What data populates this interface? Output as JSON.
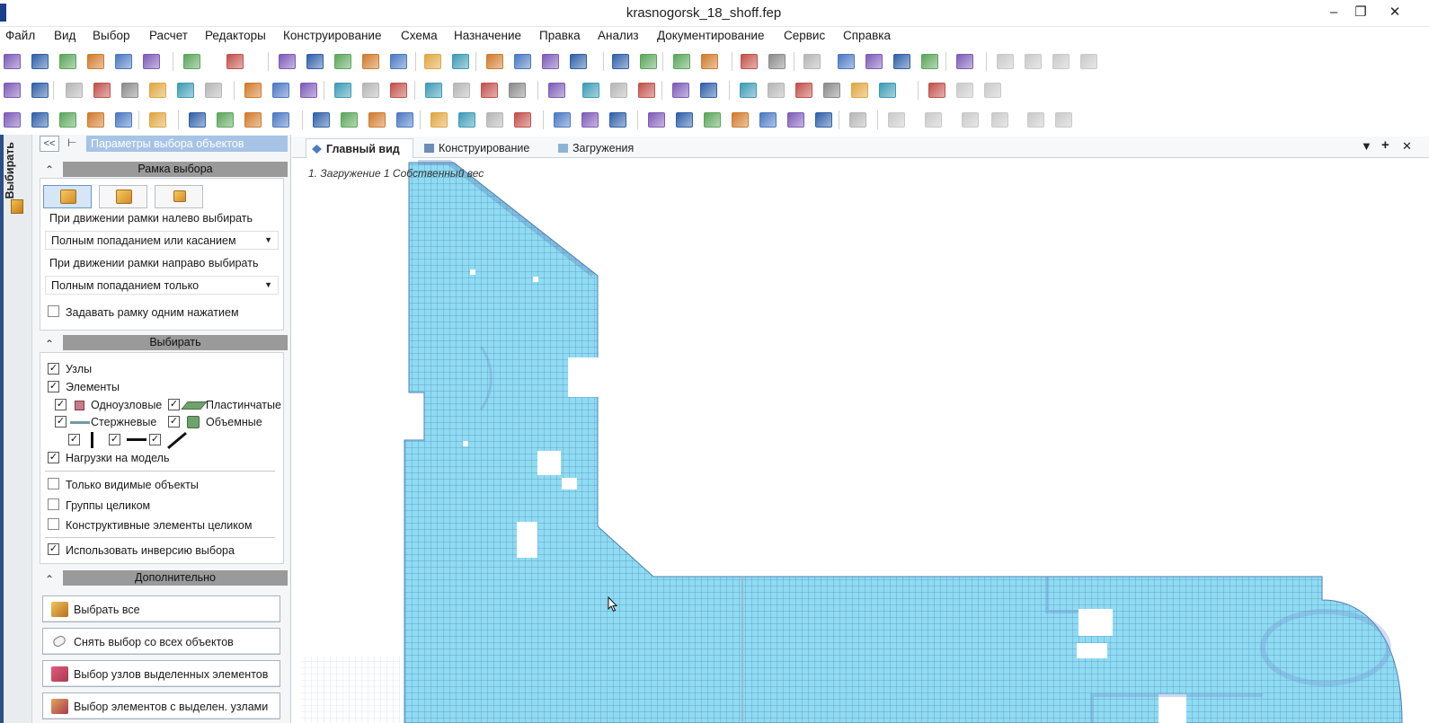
{
  "window": {
    "title": "krasnogorsk_18_shoff.fep",
    "minimize": "–",
    "restore": "❐",
    "close": "✕"
  },
  "menu": [
    "Файл",
    "Вид",
    "Выбор",
    "Расчет",
    "Редакторы",
    "Конструирование",
    "Схема",
    "Назначение",
    "Правка",
    "Анализ",
    "Документирование",
    "Сервис",
    "Справка"
  ],
  "sidebar": {
    "vertical_tab": "Выбирать"
  },
  "panel": {
    "collapse_label": "<<",
    "title": "Параметры выбора объектов",
    "frame_section": {
      "header": "Рамка выбора",
      "left_move_label": "При движении рамки налево выбирать",
      "left_move_value": "Полным попаданием или касанием",
      "right_move_label": "При движении рамки направо выбирать",
      "right_move_value": "Полным попаданием только",
      "one_click_label": "Задавать рамку одним нажатием"
    },
    "select_section": {
      "header": "Выбирать",
      "nodes": "Узлы",
      "elements": "Элементы",
      "single_node": "Одноузловые",
      "plate": "Пластинчатые",
      "rod": "Стержневые",
      "volume": "Объемные",
      "loads": "Нагрузки на модель",
      "only_visible": "Только видимые объекты",
      "groups_whole": "Группы целиком",
      "constructive_whole": "Конструктивные элементы целиком",
      "use_inversion": "Использовать инверсию выбора"
    },
    "extra_section": {
      "header": "Дополнительно",
      "select_all": "Выбрать все",
      "deselect_all": "Снять выбор со всех объектов",
      "select_nodes_of_elements": "Выбор узлов выделенных элементов",
      "select_elements_with_nodes": "Выбор элементов с выделен. узлами"
    }
  },
  "tabs": [
    "Главный вид",
    "Конструирование",
    "Загружения"
  ],
  "viewport": {
    "load_case": "1. Загружение   1 Собственный вес"
  },
  "colors": {
    "mesh_fill": "#8fdcf2",
    "mesh_line": "#5a8fc2",
    "panel_header": "#a7c3e6",
    "section_bar": "#9a9a9a"
  }
}
